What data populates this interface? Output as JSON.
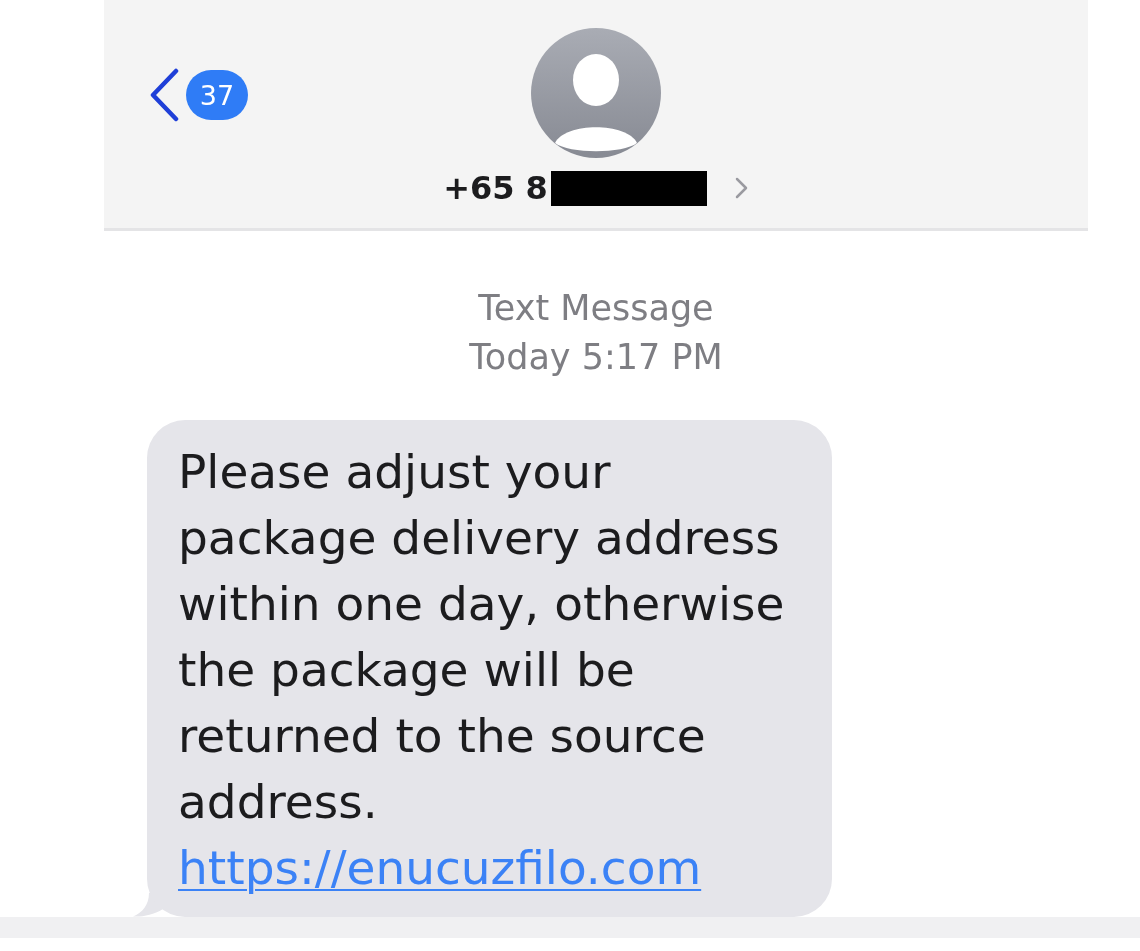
{
  "header": {
    "back_badge": "37",
    "contact": {
      "number": "+65 8",
      "redacted": true
    }
  },
  "timestamp": {
    "service": "Text Message",
    "time": "Today 5:17 PM"
  },
  "messages": [
    {
      "kind": "received",
      "text": "Please adjust your package delivery address within one day, otherwise the package will be returned to the source address.",
      "link": "https://enucuzfilo.com"
    }
  ]
}
